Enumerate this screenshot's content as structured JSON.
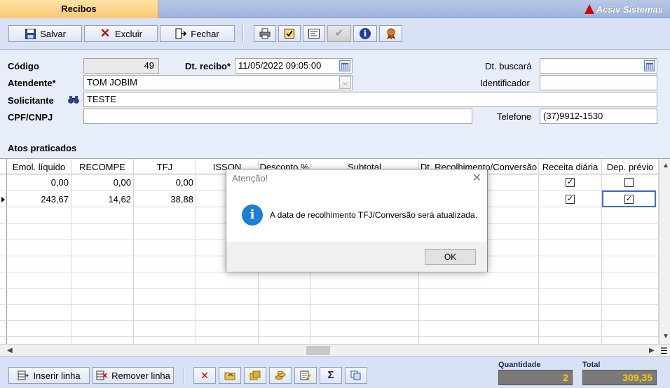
{
  "window": {
    "tab_title": "Recibos",
    "brand": "Acsiv Sistemas"
  },
  "toolbar": {
    "save_label": "Salvar",
    "delete_label": "Excluir",
    "close_label": "Fechar",
    "icons": [
      "print-icon",
      "checkbox-icon",
      "form-icon",
      "check-icon",
      "info-icon",
      "ribbon-icon"
    ]
  },
  "form": {
    "codigo_label": "Código",
    "codigo_value": "49",
    "dt_recibo_label": "Dt. recibo*",
    "dt_recibo_value": "11/05/2022 09:05:00",
    "dt_buscara_label": "Dt. buscará",
    "dt_buscara_value": "",
    "atendente_label": "Atendente*",
    "atendente_value": "TOM JOBIM",
    "identificador_label": "Identificador",
    "identificador_value": "",
    "solicitante_label": "Solicitante",
    "solicitante_value": "TESTE",
    "cpf_label": "CPF/CNPJ",
    "cpf_value": "",
    "telefone_label": "Telefone",
    "telefone_value": "(37)9912-1530",
    "atos_label": "Atos praticados"
  },
  "grid": {
    "columns": [
      "Emol. líquido",
      "RECOMPE",
      "TFJ",
      "ISSON",
      "Desconto %",
      "Subtotal",
      "Dt. Recolhimento/Conversão",
      "Receita diária",
      "Dep. prévio"
    ],
    "rows": [
      {
        "emol": "0,00",
        "recompe": "0,00",
        "tfj": "0,00",
        "receita": true,
        "deposito": false
      },
      {
        "emol": "243,67",
        "recompe": "14,62",
        "tfj": "38,88",
        "receita": true,
        "deposito": true
      }
    ]
  },
  "bottom": {
    "insert_label": "Inserir linha",
    "remove_label": "Remover linha",
    "quantidade_label": "Quantidade",
    "quantidade_value": "2",
    "total_label": "Total",
    "total_value": "309,35"
  },
  "dialog": {
    "title": "Atenção!",
    "message": "A data de recolhimento TFJ/Conversão será atualizada.",
    "ok_label": "OK"
  }
}
